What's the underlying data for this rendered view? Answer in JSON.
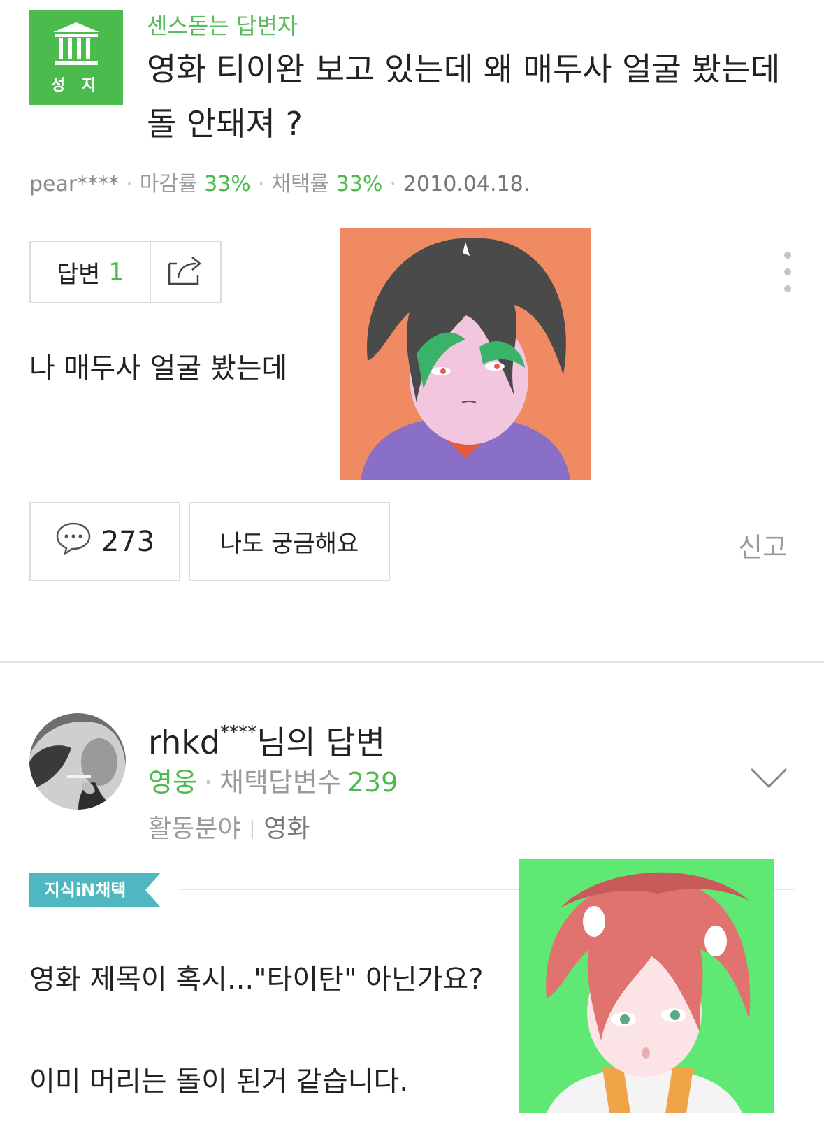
{
  "question": {
    "badge": {
      "text": "성 지",
      "icon": "bank-building-icon"
    },
    "label": "센스돋는 답변자",
    "title": "영화 티이완 보고 있는데 왜 매두사 얼굴 봤는데 돌 안돼져 ?",
    "meta": {
      "user": "pear****",
      "deadline_label": "마감률",
      "deadline_pct": "33%",
      "adopt_label": "채택률",
      "adopt_pct": "33%",
      "date": "2010.04.18."
    },
    "answers_label": "답변",
    "answers_count": "1",
    "body": "나 매두사 얼굴 봤는데",
    "comment_count": "273",
    "curious_label": "나도 궁금해요",
    "report_label": "신고"
  },
  "answer": {
    "author": "rhkd",
    "author_mask": "****",
    "author_suffix": "님의 답변",
    "rank": "영웅",
    "adopted_label": "채택답변수",
    "adopted_count": "239",
    "field_label": "활동분야",
    "field_value": "영화",
    "adopt_tag": "지식iN채택",
    "body_line1": "영화 제목이 혹시...\"타이탄\" 아닌가요?",
    "body_line2": "이미 머리는 돌이 된거 같습니다."
  },
  "colors": {
    "brand_green": "#4cbb4d",
    "tag_teal": "#4fb7c0",
    "img1_bg": "#f08a62",
    "img2_bg": "#5fe873"
  }
}
